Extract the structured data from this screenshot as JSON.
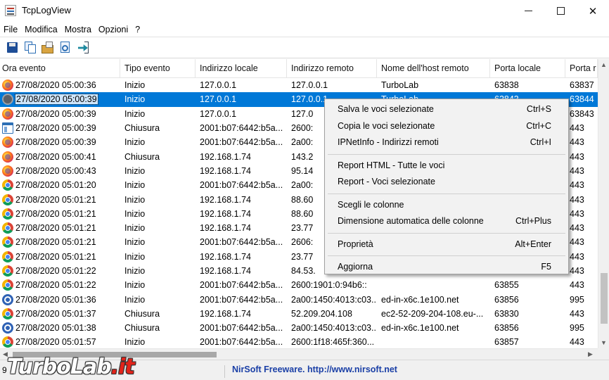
{
  "window": {
    "title": "TcpLogView",
    "min_glyph": "",
    "close_glyph": "✕"
  },
  "menu": [
    "File",
    "Modifica",
    "Mostra",
    "Opzioni",
    "?"
  ],
  "toolbar": {
    "icons": [
      "save-icon",
      "copy-icon",
      "properties-icon",
      "html-report-icon",
      "exit-icon"
    ]
  },
  "columns": [
    "Ora evento",
    "Tipo evento",
    "Indirizzo locale",
    "Indirizzo remoto",
    "Nome dell'host remoto",
    "Porta locale",
    "Porta r"
  ],
  "rows": [
    {
      "icon": "firefox",
      "time": "27/08/2020 05:00:36",
      "type": "Inizio",
      "local": "127.0.0.1",
      "remote": "127.0.0.1",
      "host": "TurboLab",
      "lport": "63838",
      "rport": "63837"
    },
    {
      "icon": "dark",
      "time": "27/08/2020 05:00:39",
      "type": "Inizio",
      "local": "127.0.0.1",
      "remote": "127.0.0.1",
      "host": "TurboLab",
      "lport": "63843",
      "rport": "63844",
      "selected": true
    },
    {
      "icon": "firefox",
      "time": "27/08/2020 05:00:39",
      "type": "Inizio",
      "local": "127.0.0.1",
      "remote": "127.0",
      "host": "",
      "lport": "",
      "rport": "63843"
    },
    {
      "icon": "app",
      "time": "27/08/2020 05:00:39",
      "type": "Chiusura",
      "local": "2001:b07:6442:b5a...",
      "remote": "2600:",
      "host": "",
      "lport": "",
      "rport": "443"
    },
    {
      "icon": "firefox",
      "time": "27/08/2020 05:00:39",
      "type": "Inizio",
      "local": "2001:b07:6442:b5a...",
      "remote": "2a00:",
      "host": "",
      "lport": "",
      "rport": "443"
    },
    {
      "icon": "firefox",
      "time": "27/08/2020 05:00:41",
      "type": "Chiusura",
      "local": "192.168.1.74",
      "remote": "143.2",
      "host": "",
      "lport": "",
      "rport": "443"
    },
    {
      "icon": "firefox",
      "time": "27/08/2020 05:00:43",
      "type": "Inizio",
      "local": "192.168.1.74",
      "remote": "95.14",
      "host": "",
      "lport": "",
      "rport": "443"
    },
    {
      "icon": "chrome",
      "time": "27/08/2020 05:01:20",
      "type": "Inizio",
      "local": "2001:b07:6442:b5a...",
      "remote": "2a00:",
      "host": "",
      "lport": "",
      "rport": "443"
    },
    {
      "icon": "chrome",
      "time": "27/08/2020 05:01:21",
      "type": "Inizio",
      "local": "192.168.1.74",
      "remote": "88.60",
      "host": "",
      "lport": "",
      "rport": "443"
    },
    {
      "icon": "chrome",
      "time": "27/08/2020 05:01:21",
      "type": "Inizio",
      "local": "192.168.1.74",
      "remote": "88.60",
      "host": "",
      "lport": "",
      "rport": "443"
    },
    {
      "icon": "chrome",
      "time": "27/08/2020 05:01:21",
      "type": "Inizio",
      "local": "192.168.1.74",
      "remote": "23.77",
      "host": "",
      "lport": "",
      "rport": "443"
    },
    {
      "icon": "chrome",
      "time": "27/08/2020 05:01:21",
      "type": "Inizio",
      "local": "2001:b07:6442:b5a...",
      "remote": "2606:",
      "host": "",
      "lport": "",
      "rport": "443"
    },
    {
      "icon": "chrome",
      "time": "27/08/2020 05:01:21",
      "type": "Inizio",
      "local": "192.168.1.74",
      "remote": "23.77",
      "host": "",
      "lport": "",
      "rport": "443"
    },
    {
      "icon": "chrome",
      "time": "27/08/2020 05:01:22",
      "type": "Inizio",
      "local": "192.168.1.74",
      "remote": "84.53.",
      "host": "",
      "lport": "",
      "rport": "443"
    },
    {
      "icon": "chrome",
      "time": "27/08/2020 05:01:22",
      "type": "Inizio",
      "local": "2001:b07:6442:b5a...",
      "remote": "2600:1901:0:94b6::",
      "host": "",
      "lport": "63855",
      "rport": "443"
    },
    {
      "icon": "people",
      "time": "27/08/2020 05:01:36",
      "type": "Inizio",
      "local": "2001:b07:6442:b5a...",
      "remote": "2a00:1450:4013:c03...",
      "host": "ed-in-x6c.1e100.net",
      "lport": "63856",
      "rport": "995"
    },
    {
      "icon": "chrome",
      "time": "27/08/2020 05:01:37",
      "type": "Chiusura",
      "local": "192.168.1.74",
      "remote": "52.209.204.108",
      "host": "ec2-52-209-204-108.eu-...",
      "lport": "63830",
      "rport": "443"
    },
    {
      "icon": "people",
      "time": "27/08/2020 05:01:38",
      "type": "Chiusura",
      "local": "2001:b07:6442:b5a...",
      "remote": "2a00:1450:4013:c03...",
      "host": "ed-in-x6c.1e100.net",
      "lport": "63856",
      "rport": "995"
    },
    {
      "icon": "chrome",
      "time": "27/08/2020 05:01:57",
      "type": "Inizio",
      "local": "2001:b07:6442:b5a...",
      "remote": "2600:1f18:465f:360...",
      "host": "",
      "lport": "63857",
      "rport": "443"
    }
  ],
  "context_menu": {
    "groups": [
      [
        {
          "label": "Salva le voci selezionate",
          "shortcut": "Ctrl+S"
        },
        {
          "label": "Copia le voci selezionate",
          "shortcut": "Ctrl+C"
        },
        {
          "label": "IPNetInfo - Indirizzi remoti",
          "shortcut": "Ctrl+I"
        }
      ],
      [
        {
          "label": "Report HTML - Tutte le voci",
          "shortcut": ""
        },
        {
          "label": "Report - Voci selezionate",
          "shortcut": ""
        }
      ],
      [
        {
          "label": "Scegli le colonne",
          "shortcut": ""
        },
        {
          "label": "Dimensione automatica delle colonne",
          "shortcut": "Ctrl+Plus"
        }
      ],
      [
        {
          "label": "Proprietà",
          "shortcut": "Alt+Enter"
        }
      ],
      [
        {
          "label": "Aggiorna",
          "shortcut": "F5"
        }
      ]
    ]
  },
  "statusbar": {
    "left_text": "9",
    "link_text": "NirSoft Freeware.  http://www.nirsoft.net"
  },
  "watermark": {
    "part1": "TurboLab",
    "part2": ".it"
  },
  "colors": {
    "selection": "#0078d7",
    "link": "#1a3fa6",
    "watermark_accent": "#e2231a"
  }
}
